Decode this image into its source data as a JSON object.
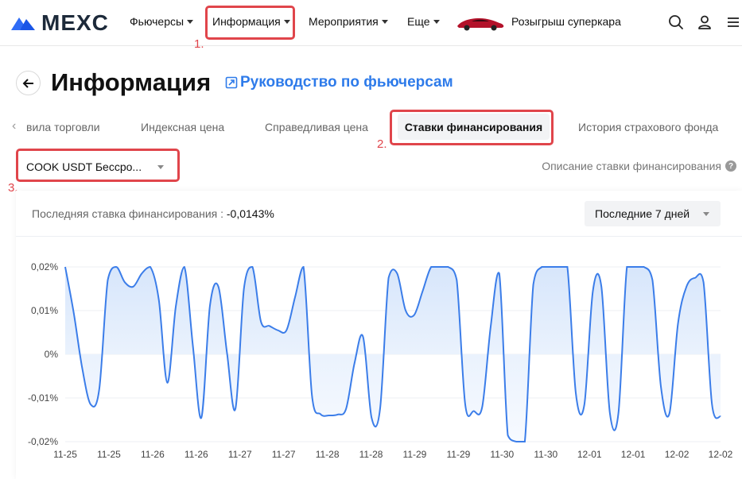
{
  "nav": {
    "brand": "MEXC",
    "items": [
      {
        "label": "Фьючерсы"
      },
      {
        "label": "Информация"
      },
      {
        "label": "Мероприятия"
      },
      {
        "label": "Еще"
      }
    ],
    "promo": "Розыгрыш суперкара"
  },
  "annotations": {
    "m1": "1.",
    "m2": "2.",
    "m3": "3."
  },
  "header": {
    "title": "Информация",
    "guide_link": "Руководство по фьючерсам"
  },
  "tabs": [
    {
      "label": "вила торговли"
    },
    {
      "label": "Индексная цена"
    },
    {
      "label": "Справедливая цена"
    },
    {
      "label": "Ставки финансирования"
    },
    {
      "label": "История страхового фонда"
    }
  ],
  "selector": {
    "value": "COOK USDT Бессро..."
  },
  "funding_desc_link": "Описание ставки финансирования",
  "card": {
    "last_rate_label": "Последняя ставка финансирования :",
    "last_rate_value": "-0,0143%",
    "period": "Последние 7 дней"
  },
  "chart_data": {
    "type": "area",
    "title": "",
    "xlabel": "",
    "ylabel": "",
    "ylim": [
      -0.02,
      0.02
    ],
    "yticks": [
      "0,02%",
      "0,01%",
      "0%",
      "-0,01%",
      "-0,02%"
    ],
    "xticks": [
      "11-25",
      "11-25",
      "11-26",
      "11-26",
      "11-27",
      "11-27",
      "11-28",
      "11-28",
      "11-29",
      "11-29",
      "11-30",
      "11-30",
      "12-01",
      "12-01",
      "12-02",
      "12-02"
    ],
    "series": [
      {
        "values": [
          0.02,
          0.0095,
          -0.0032,
          -0.0115,
          -0.008,
          0.017,
          0.02,
          0.0165,
          0.0155,
          0.0185,
          0.02,
          0.0125,
          -0.0065,
          0.011,
          0.02,
          0.002,
          -0.0145,
          0.011,
          0.0155,
          0.0005,
          -0.0125,
          0.015,
          0.02,
          0.0075,
          0.0065,
          0.0055,
          0.0055,
          0.013,
          0.02,
          -0.0095,
          -0.0137,
          -0.014,
          -0.0138,
          -0.0125,
          -0.002,
          0.004,
          -0.0145,
          -0.0125,
          0.0175,
          0.0185,
          0.01,
          0.009,
          0.0145,
          0.02,
          0.02,
          0.02,
          0.017,
          -0.0115,
          -0.013,
          -0.012,
          0.0065,
          0.0185,
          -0.0185,
          -0.02,
          -0.02,
          0.016,
          0.02,
          0.02,
          0.02,
          0.02,
          -0.009,
          -0.0115,
          0.0145,
          0.0155,
          -0.0135,
          -0.0135,
          0.02,
          0.02,
          0.02,
          0.017,
          -0.0075,
          -0.0135,
          0.007,
          0.0155,
          0.0175,
          0.0165,
          -0.0115,
          -0.0143
        ]
      }
    ]
  }
}
